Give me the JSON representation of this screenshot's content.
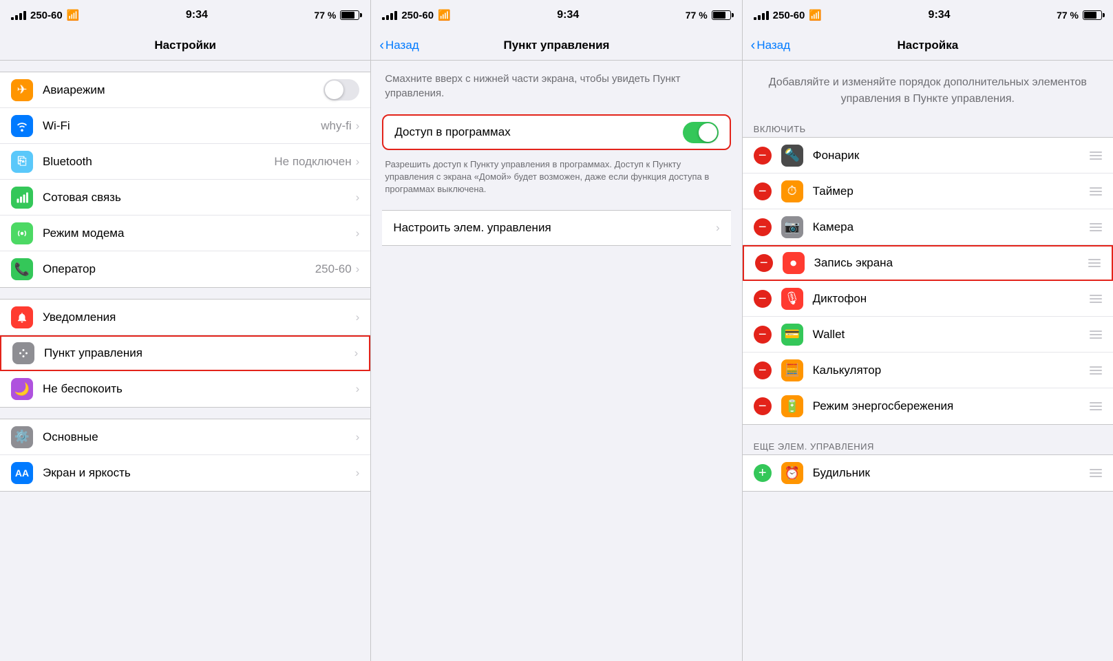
{
  "panels": [
    {
      "id": "panel1",
      "statusBar": {
        "carrier": "250-60",
        "time": "9:34",
        "battery": "77 %"
      },
      "navTitle": "Настройки",
      "groups": [
        {
          "items": [
            {
              "icon": "airplane",
              "iconColor": "orange",
              "label": "Авиарежим",
              "type": "toggle",
              "toggleOn": false,
              "value": "",
              "chevron": false
            },
            {
              "icon": "wifi",
              "iconColor": "blue",
              "label": "Wi-Fi",
              "type": "value",
              "value": "why-fi",
              "chevron": false
            },
            {
              "icon": "bluetooth",
              "iconColor": "blue2",
              "label": "Bluetooth",
              "type": "value",
              "value": "Не подключен",
              "chevron": true
            },
            {
              "icon": "cellular",
              "iconColor": "green",
              "label": "Сотовая связь",
              "type": "chevron",
              "value": "",
              "chevron": true
            },
            {
              "icon": "modem",
              "iconColor": "green2",
              "label": "Режим модема",
              "type": "chevron",
              "value": "",
              "chevron": true
            },
            {
              "icon": "phone",
              "iconColor": "green",
              "label": "Оператор",
              "type": "value",
              "value": "250-60",
              "chevron": true
            }
          ]
        },
        {
          "items": [
            {
              "icon": "notifications",
              "iconColor": "red",
              "label": "Уведомления",
              "type": "chevron",
              "value": "",
              "chevron": true,
              "highlighted": false
            },
            {
              "icon": "controlcenter",
              "iconColor": "gray",
              "label": "Пункт управления",
              "type": "chevron",
              "value": "",
              "chevron": true,
              "highlighted": true
            },
            {
              "icon": "donotdisturb",
              "iconColor": "purple",
              "label": "Не беспокоить",
              "type": "chevron",
              "value": "",
              "chevron": true,
              "highlighted": false
            }
          ]
        },
        {
          "items": [
            {
              "icon": "general",
              "iconColor": "gray",
              "label": "Основные",
              "type": "chevron",
              "value": "",
              "chevron": true
            },
            {
              "icon": "display",
              "iconColor": "blue",
              "label": "Экран и яркость",
              "type": "chevron",
              "value": "",
              "chevron": true
            }
          ]
        }
      ]
    },
    {
      "id": "panel2",
      "statusBar": {
        "carrier": "250-60",
        "time": "9:34",
        "battery": "77 %"
      },
      "navBack": "Назад",
      "navTitle": "Пункт управления",
      "description": "Смахните вверх с нижней части экрана, чтобы увидеть Пункт управления.",
      "accessToggleLabel": "Доступ в программах",
      "accessToggleOn": true,
      "accessDescription": "Разрешить доступ к Пункту управления в программах. Доступ к Пункту управления с экрана «Домой» будет возможен, даже если функция доступа в программах выключена.",
      "customizeLabel": "Настроить элем. управления",
      "highlighted": true
    },
    {
      "id": "panel3",
      "statusBar": {
        "carrier": "250-60",
        "time": "9:34",
        "battery": "77 %"
      },
      "navBack": "Назад",
      "navTitle": "Настройка",
      "headerDescription": "Добавляйте и изменяйте порядок дополнительных элементов управления в Пункте управления.",
      "includeLabel": "ВКЛЮЧИТЬ",
      "controls": [
        {
          "label": "Фонарик",
          "icon": "flashlight",
          "iconColor": "dark",
          "remove": true,
          "highlighted": false
        },
        {
          "label": "Таймер",
          "icon": "timer",
          "iconColor": "timer",
          "remove": true,
          "highlighted": false
        },
        {
          "label": "Камера",
          "icon": "camera",
          "iconColor": "gray",
          "remove": true,
          "highlighted": false
        },
        {
          "label": "Запись экрана",
          "icon": "record",
          "iconColor": "red",
          "remove": true,
          "highlighted": true
        },
        {
          "label": "Диктофон",
          "icon": "voice",
          "iconColor": "red",
          "remove": true,
          "highlighted": false
        },
        {
          "label": "Wallet",
          "icon": "wallet",
          "iconColor": "green",
          "remove": true,
          "highlighted": false
        },
        {
          "label": "Калькулятор",
          "icon": "calc",
          "iconColor": "orange",
          "remove": true,
          "highlighted": false
        },
        {
          "label": "Режим энергосбережения",
          "icon": "power",
          "iconColor": "orange",
          "remove": true,
          "highlighted": false
        }
      ],
      "moreLabel": "ЕЩЕ ЭЛЕМ. УПРАВЛЕНИЯ",
      "moreControls": [
        {
          "label": "Будильник",
          "icon": "alarm",
          "iconColor": "orange",
          "remove": false
        }
      ]
    }
  ]
}
